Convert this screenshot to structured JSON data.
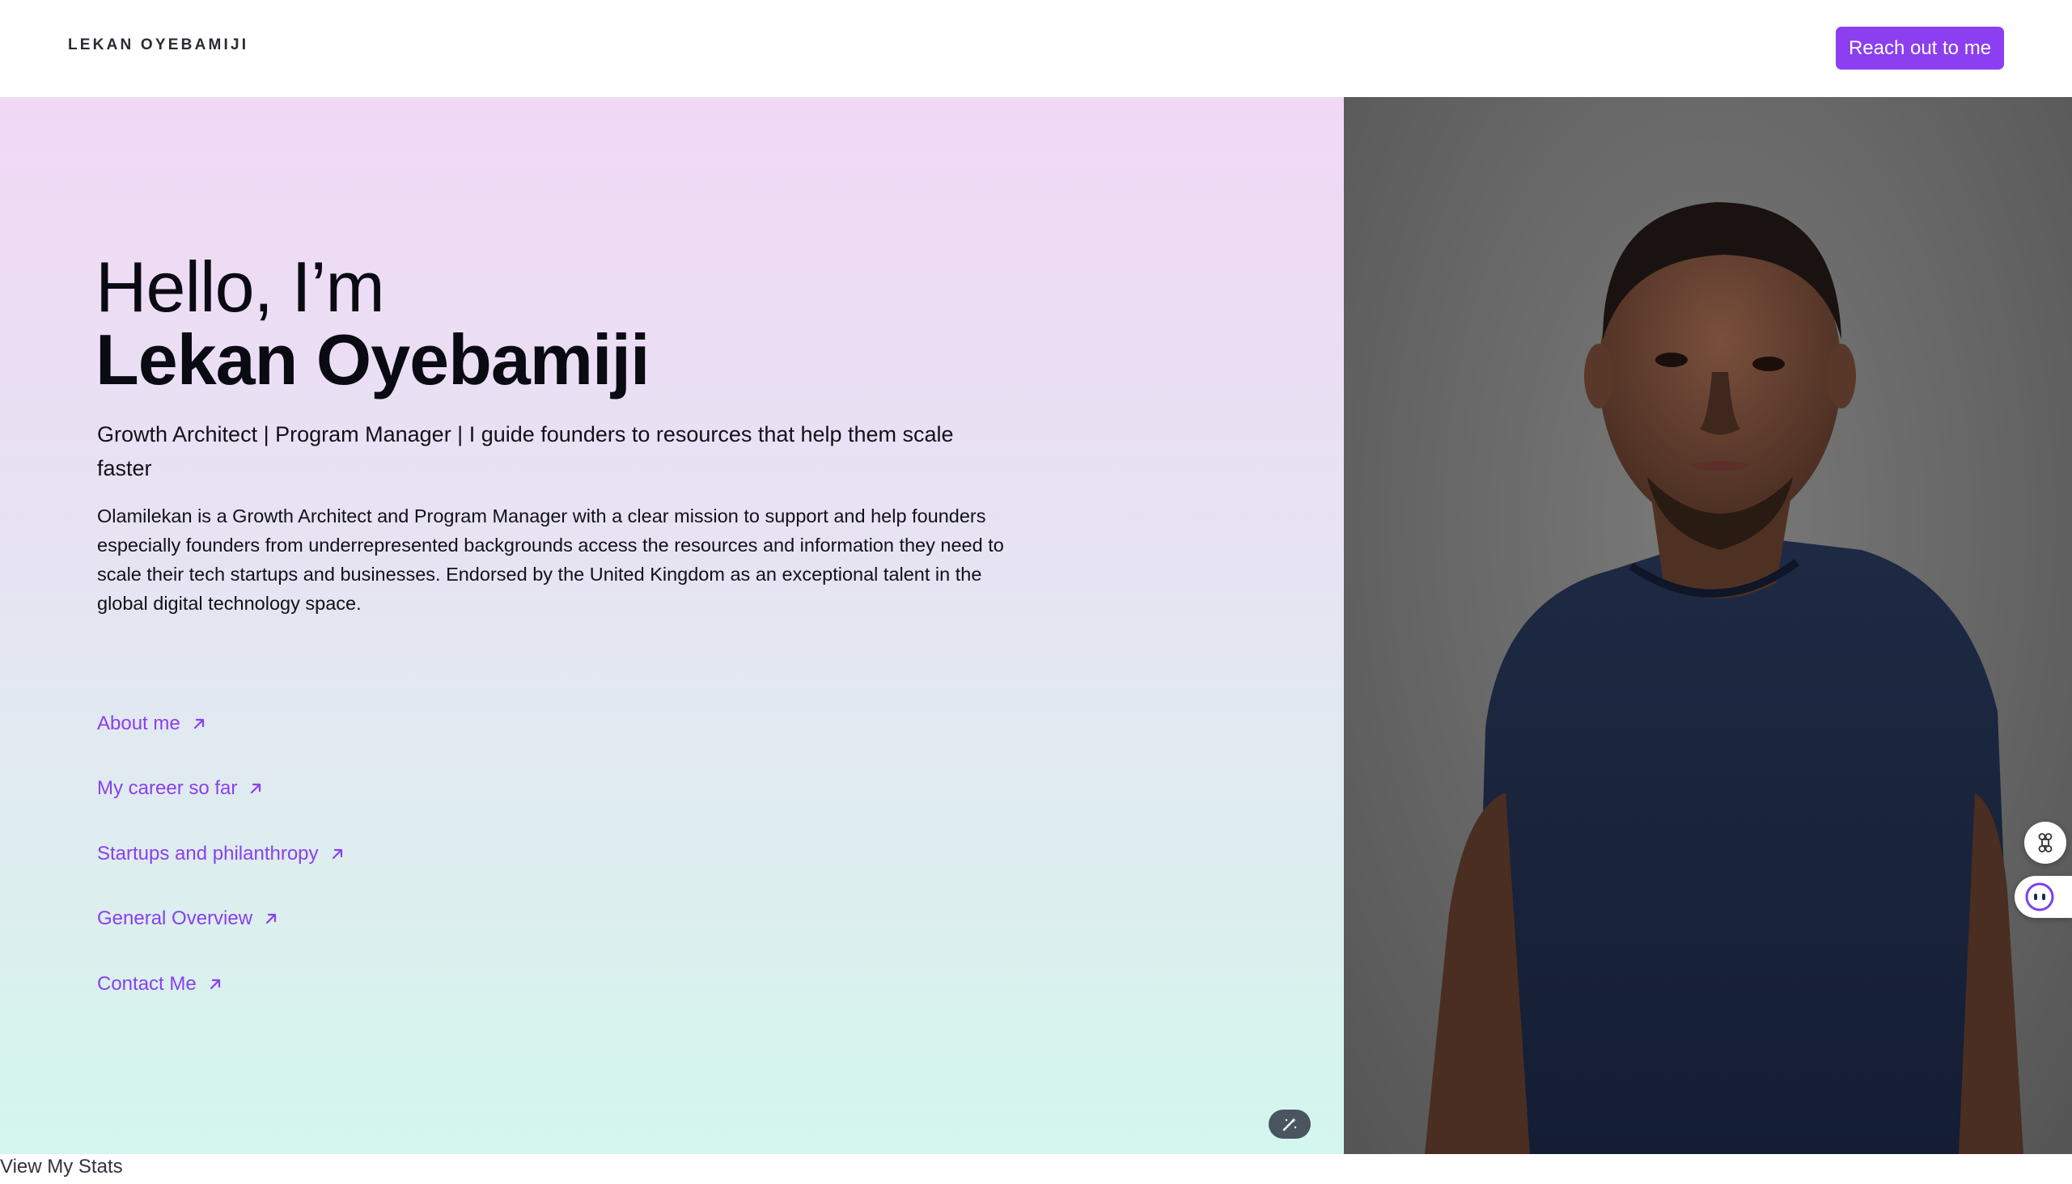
{
  "header": {
    "brand": "LEKAN OYEBAMIJI",
    "cta_label": "Reach out to me",
    "accent": "#8b3ff0"
  },
  "hero": {
    "greeting": "Hello, I’m",
    "name": "Lekan Oyebamiji",
    "tagline": "Growth Architect | Program Manager | I guide founders to resources that help them scale faster",
    "bio": "Olamilekan is a Growth Architect and Program Manager with a clear mission to support and help founders especially founders from underrepresented backgrounds access the resources and information they need to scale their tech startups and businesses. Endorsed by the United Kingdom as an exceptional talent in the global digital technology space.",
    "links": [
      {
        "label": "About me",
        "icon": "arrow-up-right-icon"
      },
      {
        "label": "My career so far",
        "icon": "arrow-up-right-icon"
      },
      {
        "label": "Startups and philanthropy",
        "icon": "arrow-up-right-icon"
      },
      {
        "label": "General Overview",
        "icon": "arrow-up-right-icon"
      },
      {
        "label": "Contact Me",
        "icon": "arrow-up-right-icon"
      }
    ]
  },
  "widgets": {
    "magic_icon": "magic-wand-icon",
    "command_icon": "command-icon",
    "chat_icon": "chat-bot-icon"
  },
  "footer": {
    "stats_link": "View My Stats"
  }
}
